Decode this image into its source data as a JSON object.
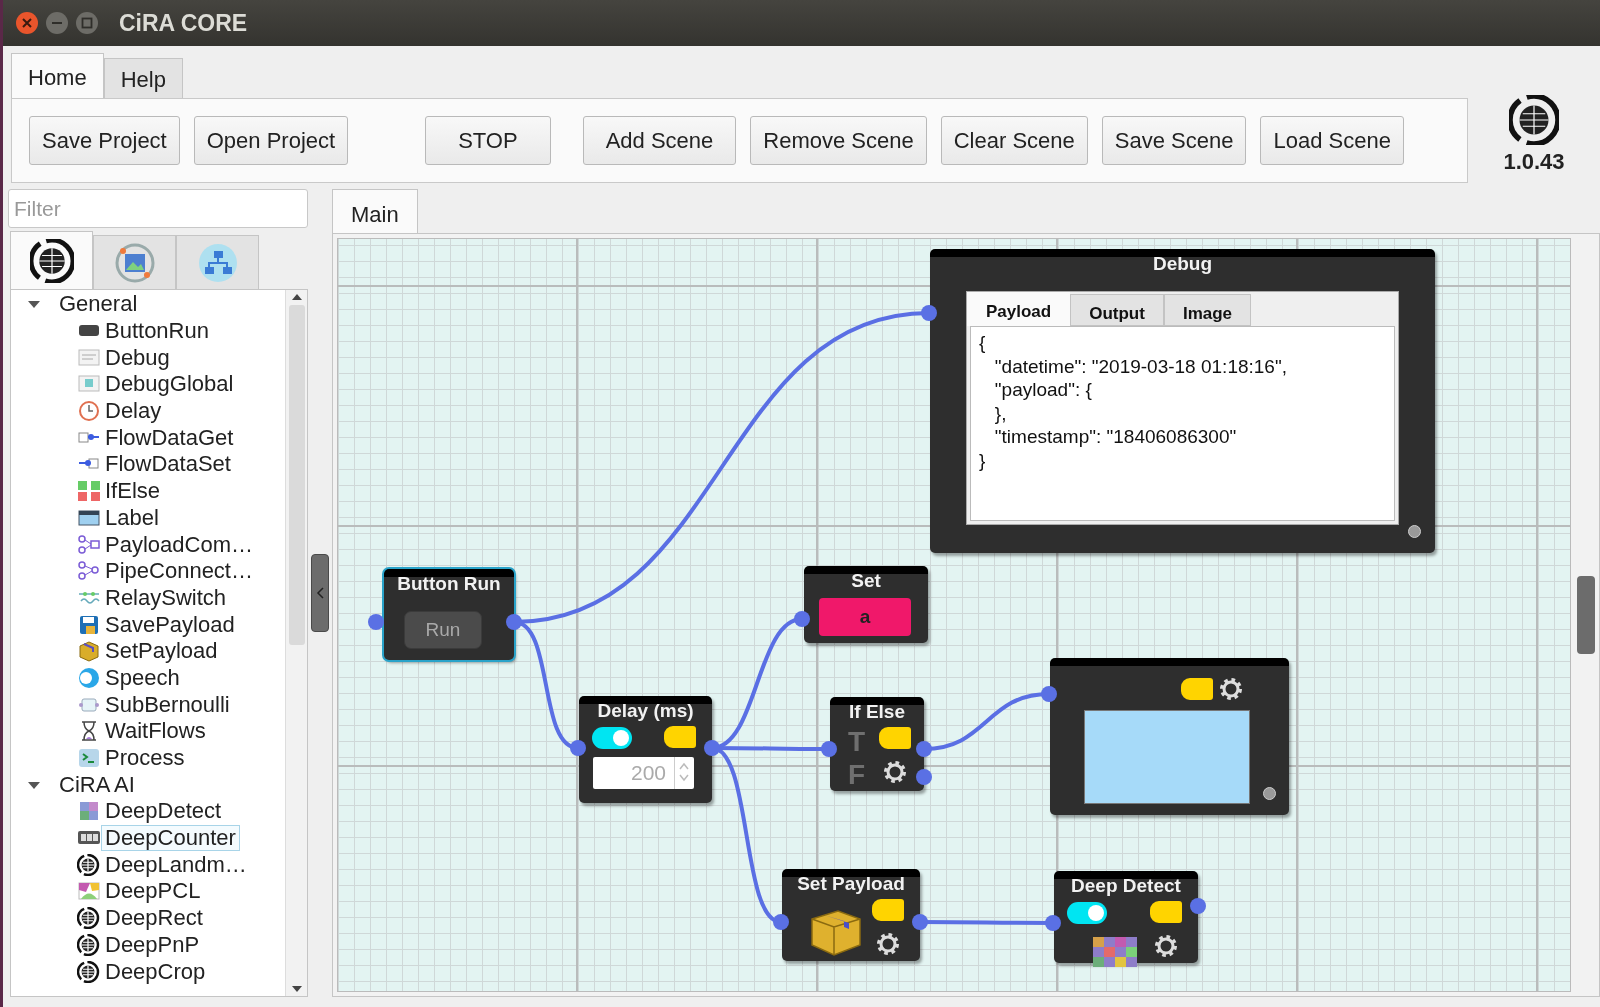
{
  "window": {
    "title": "CiRA CORE"
  },
  "menu_tabs": [
    {
      "label": "Home",
      "selected": true
    },
    {
      "label": "Help",
      "selected": false
    }
  ],
  "toolbar": {
    "buttons": [
      "Save Project",
      "Open Project",
      "STOP",
      "Add Scene",
      "Remove Scene",
      "Clear Scene",
      "Save Scene",
      "Load Scene"
    ]
  },
  "version": "1.0.43",
  "sidebar": {
    "filter": {
      "placeholder": "Filter"
    },
    "icon_tabs": [
      {
        "selected": true
      },
      {
        "selected": false
      },
      {
        "selected": false
      }
    ],
    "tree": [
      {
        "label": "General",
        "expanded": true,
        "children": [
          {
            "label": "ButtonRun",
            "selected": false
          },
          {
            "label": "Debug",
            "selected": false
          },
          {
            "label": "DebugGlobal",
            "selected": false
          },
          {
            "label": "Delay",
            "selected": false
          },
          {
            "label": "FlowDataGet",
            "selected": false
          },
          {
            "label": "FlowDataSet",
            "selected": false
          },
          {
            "label": "IfElse",
            "selected": false
          },
          {
            "label": "Label",
            "selected": false
          },
          {
            "label": "PayloadCom…",
            "selected": false
          },
          {
            "label": "PipeConnect…",
            "selected": false
          },
          {
            "label": "RelaySwitch",
            "selected": false
          },
          {
            "label": "SavePayload",
            "selected": false
          },
          {
            "label": "SetPayload",
            "selected": false
          },
          {
            "label": "Speech",
            "selected": false
          },
          {
            "label": "SubBernoulli",
            "selected": false
          },
          {
            "label": "WaitFlows",
            "selected": false
          },
          {
            "label": "Process",
            "selected": false
          }
        ]
      },
      {
        "label": "CiRA AI",
        "expanded": true,
        "children": [
          {
            "label": "DeepDetect",
            "selected": false
          },
          {
            "label": "DeepCounter",
            "selected": true
          },
          {
            "label": "DeepLandm…",
            "selected": false
          },
          {
            "label": "DeepPCL",
            "selected": false
          },
          {
            "label": "DeepRect",
            "selected": false
          },
          {
            "label": "DeepPnP",
            "selected": false
          },
          {
            "label": "DeepCrop",
            "selected": false
          }
        ]
      }
    ]
  },
  "canvas": {
    "tabs": [
      {
        "label": "Main",
        "selected": true
      }
    ],
    "nodes": [
      {
        "kind": "debug",
        "title": "Debug",
        "tabs": [
          {
            "label": "Payload",
            "selected": true
          },
          {
            "label": "Output",
            "selected": false
          },
          {
            "label": "Image",
            "selected": false
          }
        ],
        "lines": [
          "{",
          "   \"datetime\": \"2019-03-18 01:18:16\",",
          "   \"payload\": {",
          "   },",
          "   \"timestamp\": \"18406086300\"",
          "}"
        ]
      },
      {
        "kind": "button_run",
        "title": "Button Run",
        "button": "Run"
      },
      {
        "kind": "set",
        "title": "Set",
        "value": "a"
      },
      {
        "kind": "delay",
        "title": "Delay (ms)",
        "on": true,
        "value": "200"
      },
      {
        "kind": "if_else",
        "title": "If Else",
        "true_label": "T",
        "false_label": "F"
      },
      {
        "kind": "image"
      },
      {
        "kind": "set_payload",
        "title": "Set Payload"
      },
      {
        "kind": "deep_detect",
        "title": "Deep Detect",
        "on": true
      }
    ]
  }
}
